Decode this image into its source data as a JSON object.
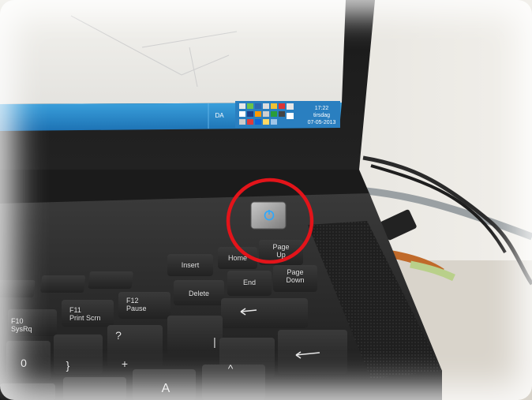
{
  "taskbar": {
    "language": "DA",
    "time": "17:22",
    "day": "tirsdag",
    "date": "07-05-2013"
  },
  "keys": {
    "insert": "Insert",
    "home": "Home",
    "page_up": "Page\nUp",
    "end": "End",
    "page_down": "Page\nDown",
    "delete": "Delete",
    "f10": "F10\nSysRq",
    "f11": "F11\nPrint Scrn",
    "f12": "F12\nPause",
    "zero": "0",
    "brace": "}",
    "question": "?",
    "plus": "+",
    "pipe": "|",
    "caret": "^",
    "a": "A"
  },
  "colors": {
    "highlight_circle": "#e3141a",
    "power_led": "#2aa8ff",
    "taskbar": "#2e8fd0"
  }
}
